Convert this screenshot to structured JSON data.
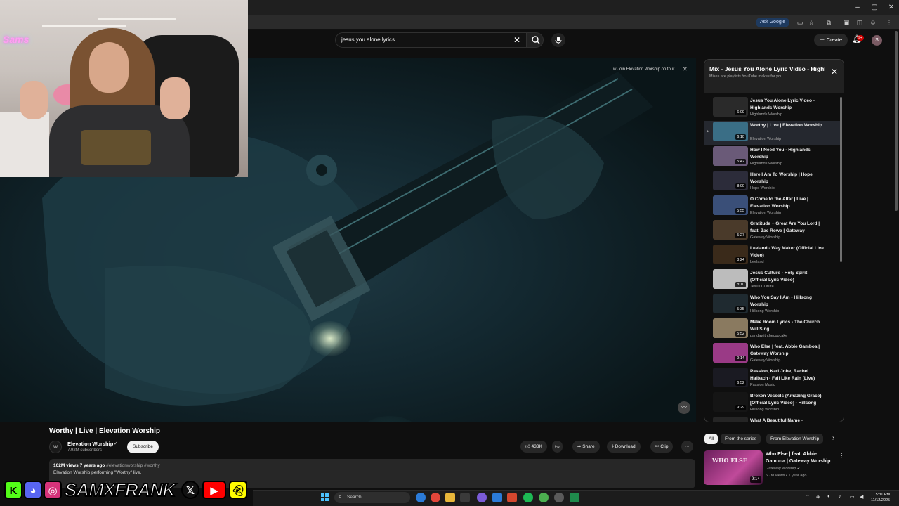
{
  "browser": {
    "ask_google": "Ask Google",
    "window_controls": [
      "–",
      "▢",
      "✕"
    ]
  },
  "search": {
    "query": "jesus you alone lyrics",
    "placeholder": "Search"
  },
  "header": {
    "create_label": "Create",
    "notification_count": "9+",
    "avatar_letter": "S"
  },
  "video": {
    "title": "Worthy | Live | Elevation Worship",
    "join_tour": "Join Elevation Worship on tour",
    "channel": {
      "name": "Elevation Worship",
      "subscribers": "7.92M subscribers",
      "subscribe_label": "Subscribe"
    },
    "actions": {
      "likes": "433K",
      "share": "Share",
      "download": "Download",
      "clip": "Clip"
    },
    "description": {
      "views_date": "102M views  7 years ago",
      "tags": "#elevationworship #worthy",
      "text": "Elevation Worship performing \"Worthy\" live."
    }
  },
  "mix": {
    "title": "Mix - Jesus You Alone Lyric Video - Highlands Worship",
    "subtitle": "Mixes are playlists YouTube makes for you",
    "items": [
      {
        "title": "Jesus You Alone Lyric Video - Highlands Worship",
        "channel": "Highlands Worship",
        "duration": "6:09",
        "color": "#2a2a2a",
        "active": false
      },
      {
        "title": "Worthy | Live | Elevation Worship",
        "channel": "Elevation Worship",
        "duration": "6:10",
        "color": "#3a6e86",
        "active": true
      },
      {
        "title": "How I Need You - Highlands Worship",
        "channel": "Highlands Worship",
        "duration": "5:42",
        "color": "#6a5a78",
        "active": false
      },
      {
        "title": "Here I Am To Worship | Hope Worship",
        "channel": "Hope Worship",
        "duration": "8:00",
        "color": "#2c2c3a",
        "active": false
      },
      {
        "title": "O Come to the Altar | Live | Elevation Worship",
        "channel": "Elevation Worship",
        "duration": "5:55",
        "color": "#3a4f78",
        "active": false
      },
      {
        "title": "Gratitude + Great Are You Lord | feat. Zac Rowe | Gateway Worship",
        "channel": "Gateway Worship",
        "duration": "5:27",
        "color": "#4a3a2a",
        "active": false
      },
      {
        "title": "Leeland - Way Maker (Official Live Video)",
        "channel": "Leeland",
        "duration": "8:24",
        "color": "#3a2a1a",
        "active": false
      },
      {
        "title": "Jesus Culture - Holy Spirit (Official Lyric Video)",
        "channel": "Jesus Culture",
        "duration": "8:10",
        "color": "#bcbcbc",
        "active": false
      },
      {
        "title": "Who You Say I Am - Hillsong Worship",
        "channel": "Hillsong Worship",
        "duration": "5:35",
        "color": "#1f2a30",
        "active": false
      },
      {
        "title": "Make Room Lyrics - The Church Will Sing",
        "channel": "pandawiththecupcake",
        "duration": "5:52",
        "color": "#8a7a60",
        "active": false
      },
      {
        "title": "Who Else | feat. Abbie Gamboa | Gateway Worship",
        "channel": "Gateway Worship",
        "duration": "9:14",
        "color": "#9a3a86",
        "active": false
      },
      {
        "title": "Passion, Karl Jobe, Rachel Halbach - Fall Like Rain (Live)",
        "channel": "Passion Music",
        "duration": "6:52",
        "color": "#1a1a22",
        "active": false
      },
      {
        "title": "Broken Vessels (Amazing Grace) [Official Lyric Video] - Hillsong Worship",
        "channel": "Hillsong Worship",
        "duration": "9:29",
        "color": "#151515",
        "active": false
      },
      {
        "title": "What A Beautiful Name -",
        "channel": "",
        "duration": "",
        "color": "#252525",
        "active": false
      }
    ]
  },
  "chips": [
    "All",
    "From the series",
    "From Elevation Worship"
  ],
  "recommendation": {
    "title": "Who Else | feat. Abbie Gamboa | Gateway Worship",
    "channel": "Gateway Worship",
    "meta": "6.7M views • 1 year ago",
    "duration": "9:14",
    "thumb_text": "WHO ELSE"
  },
  "overlay": {
    "brand_name": "SAMXFRANK",
    "webcam_sign": "Sams"
  },
  "taskbar": {
    "search_label": "Search",
    "time": "5:31 PM",
    "date": "11/12/2025"
  }
}
